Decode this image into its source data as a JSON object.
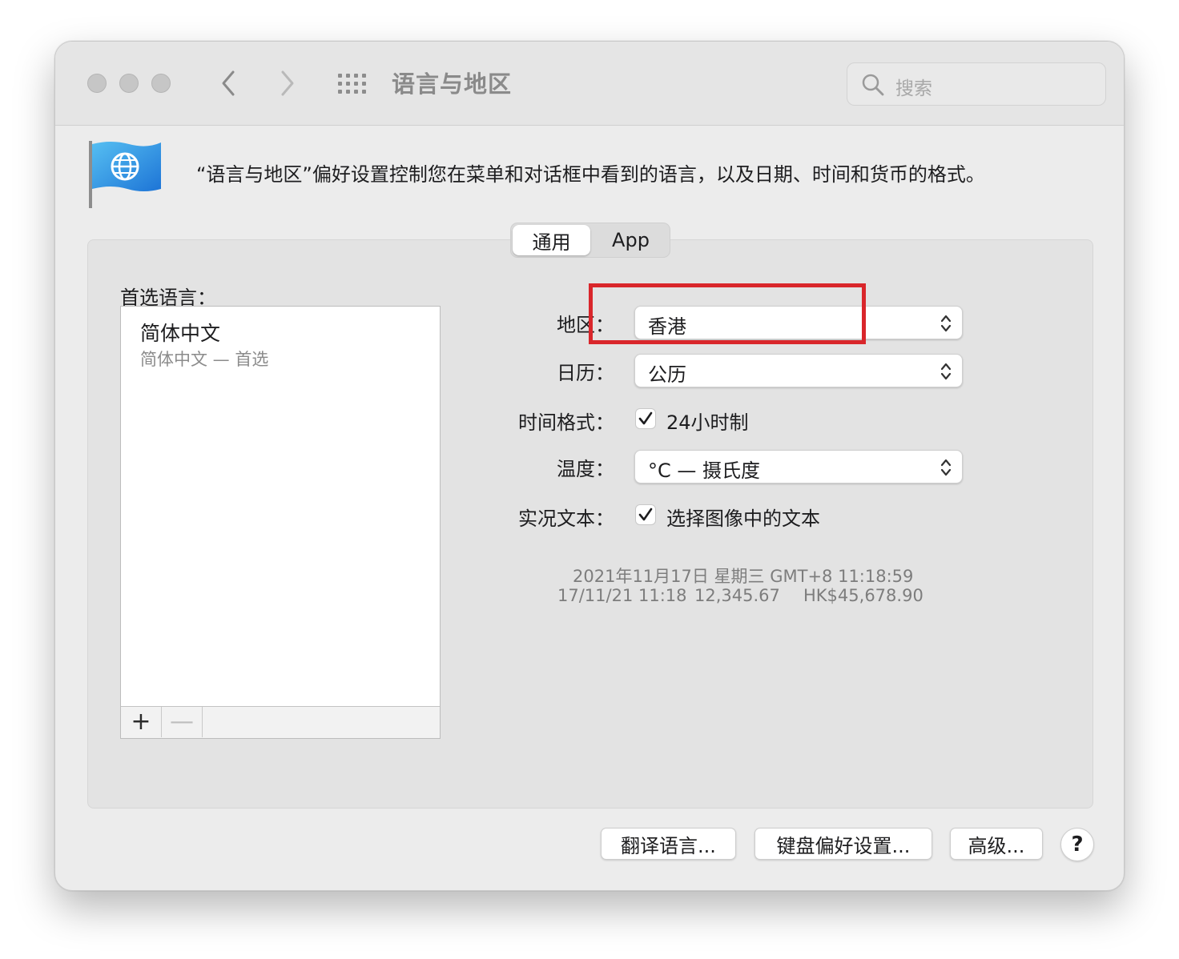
{
  "window": {
    "title": "语言与地区",
    "traffic_lights": [
      "close",
      "minimize",
      "zoom"
    ]
  },
  "search": {
    "placeholder": "搜索"
  },
  "header": {
    "icon": "globe-flag-icon",
    "description": "“语言与地区”偏好设置控制您在菜单和对话框中看到的语言，以及日期、时间和货币的格式。"
  },
  "tabs": [
    {
      "label": "通用",
      "selected": true
    },
    {
      "label": "App",
      "selected": false
    }
  ],
  "preferred_languages": {
    "label": "首选语言：",
    "items": [
      {
        "name": "简体中文",
        "sub": "简体中文 — 首选"
      }
    ],
    "add_label": "+",
    "remove_label": "—"
  },
  "settings": {
    "region": {
      "label": "地区：",
      "value": "香港"
    },
    "calendar": {
      "label": "日历：",
      "value": "公历"
    },
    "time_format": {
      "label": "时间格式：",
      "checkbox": "24小时制",
      "checked": true
    },
    "temperature": {
      "label": "温度：",
      "value": "°C — 摄氏度"
    },
    "live_text": {
      "label": "实况文本：",
      "checkbox": "选择图像中的文本",
      "checked": true
    }
  },
  "sample": {
    "line1": "2021年11月17日 星期三 GMT+8 11:18:59",
    "short_date": "17/11/21 11:18",
    "number": "12,345.67",
    "currency": "HK$45,678.90"
  },
  "buttons": {
    "translate": "翻译语言...",
    "keyboard": "键盘偏好设置...",
    "advanced": "高级...",
    "help": "?"
  },
  "colors": {
    "highlight": "#d9262b",
    "window_bg": "#ececec"
  }
}
